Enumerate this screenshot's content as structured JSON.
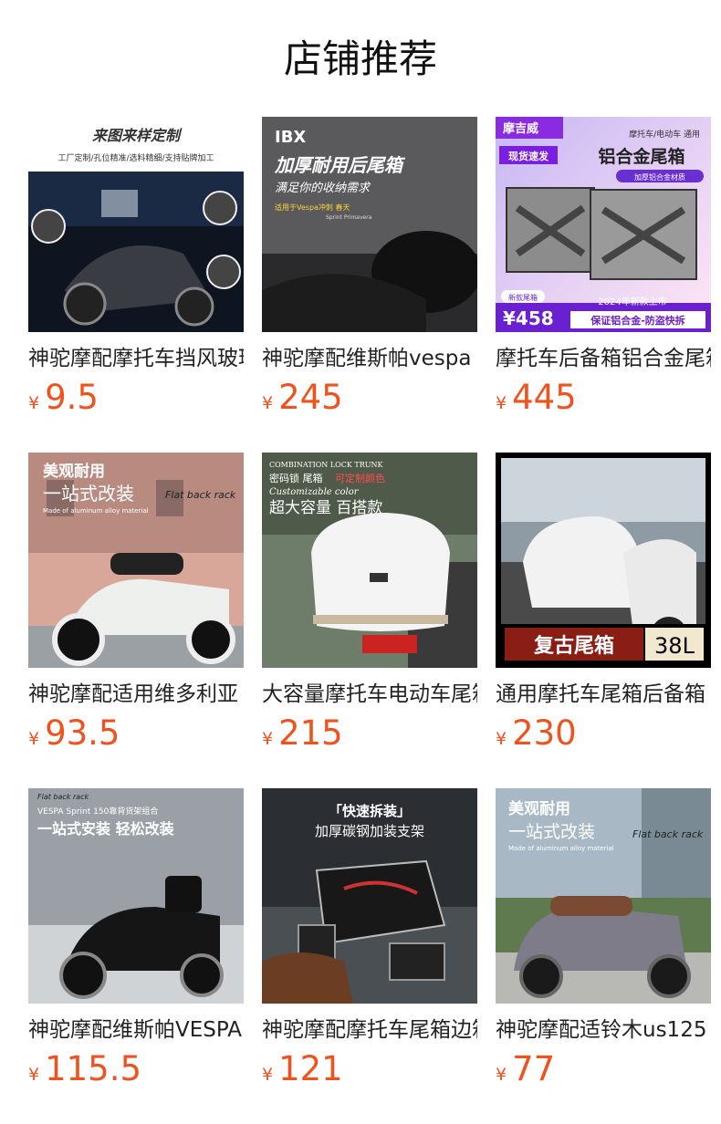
{
  "page": {
    "title": "店铺推荐"
  },
  "currency_symbol": "¥",
  "products": [
    {
      "name": "神驼摩配摩托车挡风玻璃",
      "price": "9.5",
      "image_text": {
        "headline": "来图来样定制",
        "sub": "工厂定制/孔位精准/选料精细/支持贴牌加工"
      }
    },
    {
      "name": "神驼摩配维斯帕vespa",
      "price": "245",
      "image_text": {
        "brand": "IBX",
        "headline": "加厚耐用后尾箱",
        "sub": "满足你的收纳需求",
        "tag": "适用于Vespa冲刺 春天",
        "tag2": "Sprint  Primavera"
      }
    },
    {
      "name": "摩托车后备箱铝合金尾箱",
      "price": "445",
      "image_text": {
        "brand": "摩吉威",
        "top": "摩托车/电动车 通用",
        "badge": "现货速发",
        "headline": "铝合金尾箱",
        "pill": "加厚铝合金材质",
        "new": "新款尾箱",
        "price": "¥458",
        "year": "2024年新款上市",
        "bottom": "保证铝合金-防盗快拆"
      }
    },
    {
      "name": "神驼摩配适用维多利亚",
      "price": "93.5",
      "image_text": {
        "line1": "美观耐用",
        "line2": "一站式改装",
        "en": "Flat back rack",
        "small": "Made of aluminum alloy material"
      }
    },
    {
      "name": "大容量摩托车电动车尾箱",
      "price": "215",
      "image_text": {
        "en": "COMBINATION LOCK TRUNK",
        "line1": "密码锁 尾箱",
        "accent": "可定制颜色",
        "line2": "Customizable color",
        "headline": "超大容量 百搭款"
      }
    },
    {
      "name": "通用摩托车尾箱后备箱",
      "price": "230",
      "image_text": {
        "headline": "复古尾箱",
        "size": "38L"
      }
    },
    {
      "name": "神驼摩配维斯帕VESPA",
      "price": "115.5",
      "image_text": {
        "en": "Flat back rack",
        "sub": "VESPA Sprint 150靠背货架组合",
        "headline": "一站式安装 轻松改装"
      }
    },
    {
      "name": "神驼摩配摩托车尾箱边箱",
      "price": "121",
      "image_text": {
        "line1": "「快速拆装」",
        "line2": "加厚碳钢加装支架"
      }
    },
    {
      "name": "神驼摩配适铃木us125",
      "price": "77",
      "image_text": {
        "line1": "美观耐用",
        "line2": "一站式改装",
        "en": "Flat back rack",
        "small": "Made of aluminum alloy material"
      }
    }
  ]
}
